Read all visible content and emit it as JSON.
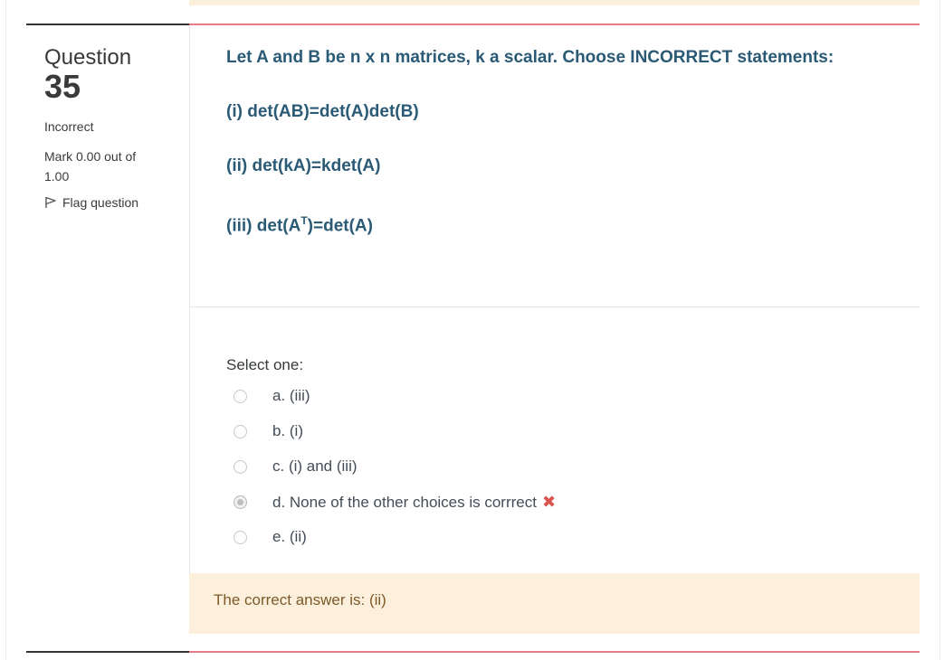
{
  "info": {
    "question_word": "Question",
    "question_number": "35",
    "state": "Incorrect",
    "grade": "Mark 0.00 out of 1.00",
    "flag_label": "Flag question",
    "flag_icon": "flag-icon"
  },
  "question": {
    "stem": "Let A and B be n x n matrices, k a scalar. Choose INCORRECT statements:",
    "statement_i": "(i) det(AB)=det(A)det(B)",
    "statement_ii": "(ii) det(kA)=kdet(A)",
    "statement_iii_pre": "(iii) det(A",
    "statement_iii_sup": "T",
    "statement_iii_post": ")=det(A)"
  },
  "answer": {
    "prompt": "Select one:",
    "options": [
      {
        "label": "a. (iii)",
        "selected": false
      },
      {
        "label": "b. (i)",
        "selected": false
      },
      {
        "label": "c. (i) and (iii)",
        "selected": false
      },
      {
        "label": "d. None of the other choices is corrrect",
        "selected": true,
        "mark": "✖"
      },
      {
        "label": "e. (ii)",
        "selected": false
      }
    ]
  },
  "feedback": {
    "right_answer": "The correct answer is: (ii)"
  },
  "colors": {
    "question_text": "#2a5a75",
    "incorrect_mark": "#d9534f",
    "feedback_bg": "#fcefdc",
    "feedback_text": "#7d5a29",
    "separator_red": "#e97a8a"
  }
}
